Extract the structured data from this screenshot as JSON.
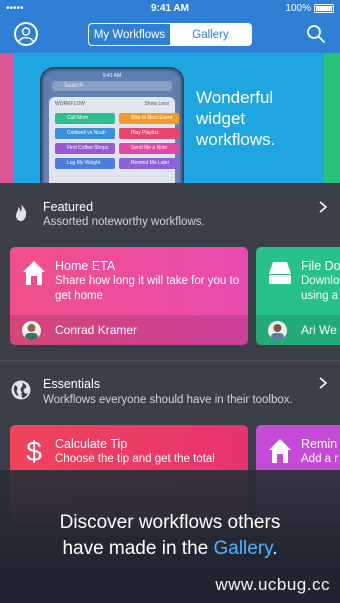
{
  "status_bar": {
    "carrier": "•••••",
    "time": "9:41 AM",
    "battery": "100%"
  },
  "header": {
    "segments": [
      "My Workflows",
      "Gallery"
    ],
    "selected": "Gallery",
    "colors": {
      "accent": "#2f7fd7"
    }
  },
  "banner": {
    "text": "Wonderful widget workflows.",
    "phone": {
      "time": "9:41 AM",
      "search_placeholder": "Search",
      "widget_title": "WORKFLOW",
      "widget_action": "Show Less",
      "buttons": [
        "Call Mom",
        "Bike to Next Event",
        "Coldwell vs Noah",
        "Play Playlist",
        "Find Coffee Shops",
        "Send Me a Note",
        "Log My Weight",
        "Remind Me Later"
      ]
    }
  },
  "featured": {
    "title": "Featured",
    "subtitle": "Assorted noteworthy workflows.",
    "cards": [
      {
        "title": "Home ETA",
        "description": "Share how long it will take for you to get home",
        "author": "Conrad Kramer",
        "color": "#ee4e86",
        "icon": "home-icon"
      },
      {
        "title": "File Do",
        "description": "Downlo using a",
        "author": "Ari We",
        "color": "#27c28a",
        "icon": "file-icon"
      }
    ]
  },
  "essentials": {
    "title": "Essentials",
    "subtitle": "Workflows everyone should have in their toolbox.",
    "cards": [
      {
        "title": "Calculate Tip",
        "description": "Choose the tip and get the total",
        "color": "#ef3b5d",
        "icon": "dollar-icon"
      },
      {
        "title": "Remin",
        "description": "Add a r",
        "color": "#c44bd6",
        "icon": "home-icon"
      }
    ]
  },
  "overlay": {
    "line1": "Discover workflows others",
    "line2_prefix": "have made in the ",
    "line2_link": "Gallery",
    "line2_suffix": "."
  },
  "watermark": "www.ucbug.cc"
}
